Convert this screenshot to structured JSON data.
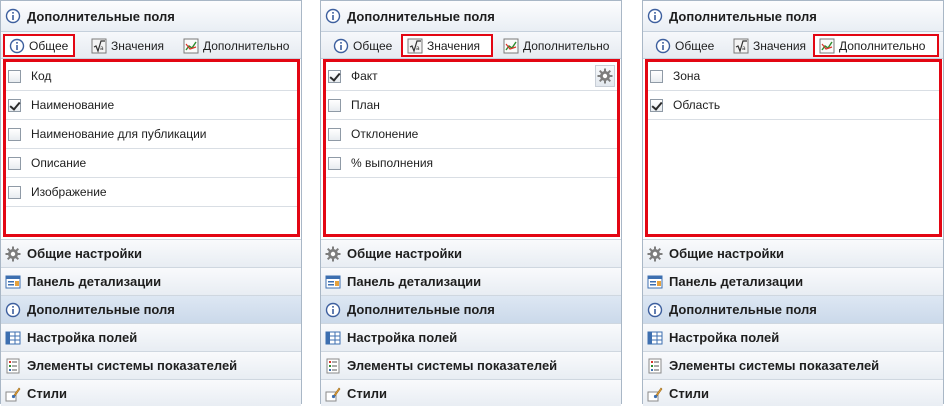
{
  "panels": [
    {
      "title": "Дополнительные поля",
      "tabs": [
        {
          "label": "Общее",
          "icon": "info-icon",
          "active": true
        },
        {
          "label": "Значения",
          "icon": "sqrt-icon",
          "active": false
        },
        {
          "label": "Дополнительно",
          "icon": "chart-icon",
          "active": false
        }
      ],
      "items": [
        {
          "label": "Код",
          "checked": false
        },
        {
          "label": "Наименование",
          "checked": true
        },
        {
          "label": "Наименование для публикации",
          "checked": false
        },
        {
          "label": "Описание",
          "checked": false
        },
        {
          "label": "Изображение",
          "checked": false
        }
      ]
    },
    {
      "title": "Дополнительные поля",
      "tabs": [
        {
          "label": "Общее",
          "icon": "info-icon",
          "active": false
        },
        {
          "label": "Значения",
          "icon": "sqrt-icon",
          "active": true
        },
        {
          "label": "Дополнительно",
          "icon": "chart-icon",
          "active": false
        }
      ],
      "items": [
        {
          "label": "Факт",
          "checked": true
        },
        {
          "label": "План",
          "checked": false
        },
        {
          "label": "Отклонение",
          "checked": false
        },
        {
          "label": "% выполнения",
          "checked": false
        }
      ]
    },
    {
      "title": "Дополнительные поля",
      "tabs": [
        {
          "label": "Общее",
          "icon": "info-icon",
          "active": false
        },
        {
          "label": "Значения",
          "icon": "sqrt-icon",
          "active": false
        },
        {
          "label": "Дополнительно",
          "icon": "chart-icon",
          "active": true
        }
      ],
      "items": [
        {
          "label": "Зона",
          "checked": false
        },
        {
          "label": "Область",
          "checked": true
        }
      ]
    }
  ],
  "sections": [
    {
      "label": "Общие настройки",
      "icon": "gear-icon",
      "active": false
    },
    {
      "label": "Панель детализации",
      "icon": "detail-panel-icon",
      "active": false
    },
    {
      "label": "Дополнительные поля",
      "icon": "info-icon",
      "active": true
    },
    {
      "label": "Настройка полей",
      "icon": "columns-icon",
      "active": false
    },
    {
      "label": "Элементы системы показателей",
      "icon": "list-icon",
      "active": false
    },
    {
      "label": "Стили",
      "icon": "brush-icon",
      "active": false
    }
  ],
  "colors": {
    "highlight": "#e30613",
    "active_section": "#cbd9ea",
    "border": "#a9b7c6"
  }
}
